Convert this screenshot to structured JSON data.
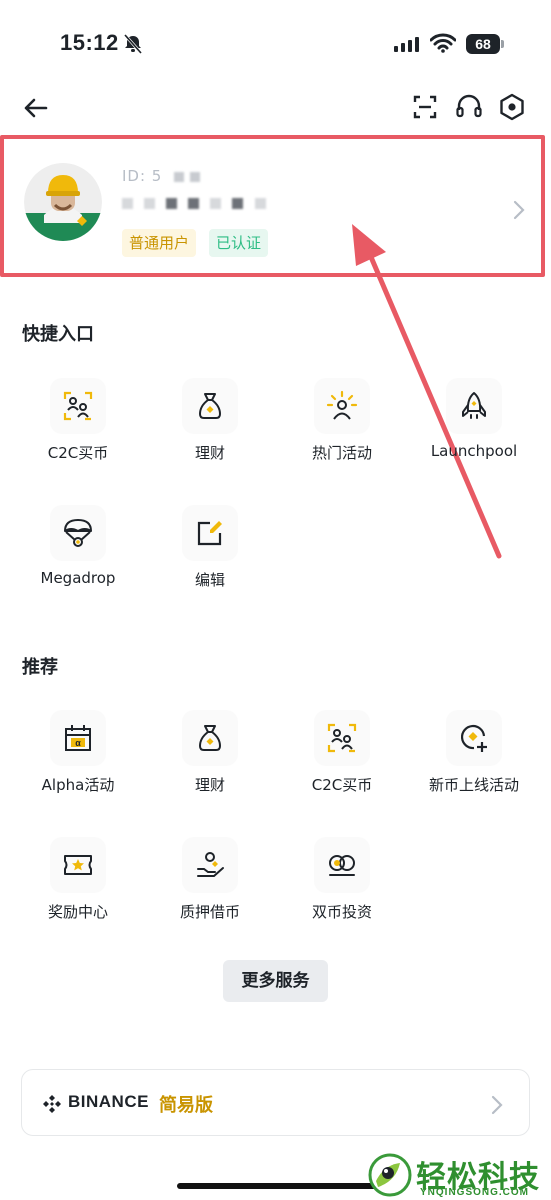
{
  "status_bar": {
    "time": "15:12",
    "battery": "68"
  },
  "profile": {
    "uid_prefix": "ID: 5 ",
    "badge_user": "普通用户",
    "badge_verified": "已认证"
  },
  "quick_access": {
    "title": "快捷入口",
    "items": [
      {
        "label": "C2C买币",
        "icon": "c2c-people-icon"
      },
      {
        "label": "理财",
        "icon": "money-bag-icon"
      },
      {
        "label": "热门活动",
        "icon": "hot-activity-icon"
      },
      {
        "label": "Launchpool",
        "icon": "rocket-icon"
      },
      {
        "label": "Megadrop",
        "icon": "parachute-icon"
      },
      {
        "label": "编辑",
        "icon": "edit-icon"
      }
    ]
  },
  "recommended": {
    "title": "推荐",
    "items": [
      {
        "label": "Alpha活动",
        "icon": "alpha-calendar-icon"
      },
      {
        "label": "理财",
        "icon": "money-bag-icon"
      },
      {
        "label": "C2C买币",
        "icon": "c2c-people-icon"
      },
      {
        "label": "新币上线活动",
        "icon": "new-coin-icon"
      },
      {
        "label": "奖励中心",
        "icon": "reward-ticket-icon"
      },
      {
        "label": "质押借币",
        "icon": "pledge-loan-icon"
      },
      {
        "label": "双币投资",
        "icon": "dual-coin-icon"
      }
    ]
  },
  "more_services": "更多服务",
  "lite_mode": {
    "brand": "BINANCE",
    "label": "简易版"
  },
  "watermark": {
    "text": "轻松科技",
    "sub": "YNQINGSONG.COM"
  },
  "colors": {
    "accent": "#F0B90B",
    "badge_user": "#C99400",
    "badge_verified": "#2EBD85",
    "annotation": "#E85A64"
  }
}
